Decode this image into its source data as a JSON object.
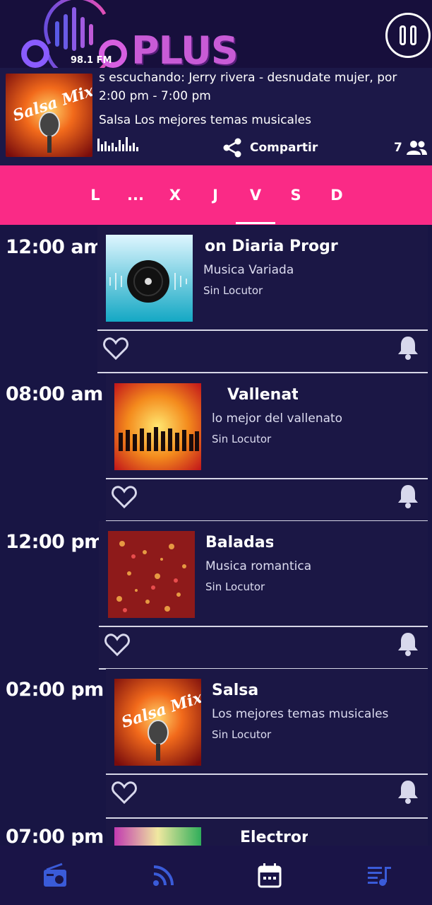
{
  "header": {
    "logo_text": "PLUS",
    "logo_freq": "98.1 FM"
  },
  "now_playing": {
    "ticker": "s escuchando: Jerry rivera  -  desnudate mujer, por",
    "time_range": "2:00 pm - 7:00 pm",
    "description": "Salsa  Los mejores temas musicales",
    "share_label": "Compartir",
    "listeners_count": "7",
    "cover_icon": "salsa-mix-cover"
  },
  "days": [
    "L",
    "...",
    "X",
    "J",
    "V",
    "S",
    "D"
  ],
  "selected_day": "V",
  "schedule": [
    {
      "time": "12:00 am",
      "title": "on Diaria        Progr",
      "subtitle": "Musica Variada",
      "host": "Sin Locutor",
      "image": "vinyl-record"
    },
    {
      "time": "08:00 am",
      "title": "Vallenat",
      "subtitle": "lo mejor del vallenato",
      "host": "Sin Locutor",
      "image": "dancing-crowd"
    },
    {
      "time": "12:00 pm",
      "title": "Baladas",
      "subtitle": "Musica romantica",
      "host": "Sin Locutor",
      "image": "hearts-bokeh"
    },
    {
      "time": "02:00 pm",
      "title": "Salsa",
      "subtitle": "Los mejores temas musicales",
      "host": "Sin Locutor",
      "image": "salsa-mix-cover"
    },
    {
      "time": "07:00 pm",
      "title": "Electror",
      "subtitle": "",
      "host": "",
      "image": "electro-lights"
    }
  ],
  "colors": {
    "background": "#181544",
    "accent_pink": "#fa2a86",
    "nav_blue": "#3a5bd9"
  },
  "bottom_nav": [
    "radio-icon",
    "podcast-icon",
    "calendar-icon",
    "playlist-icon"
  ],
  "active_nav": "calendar-icon"
}
